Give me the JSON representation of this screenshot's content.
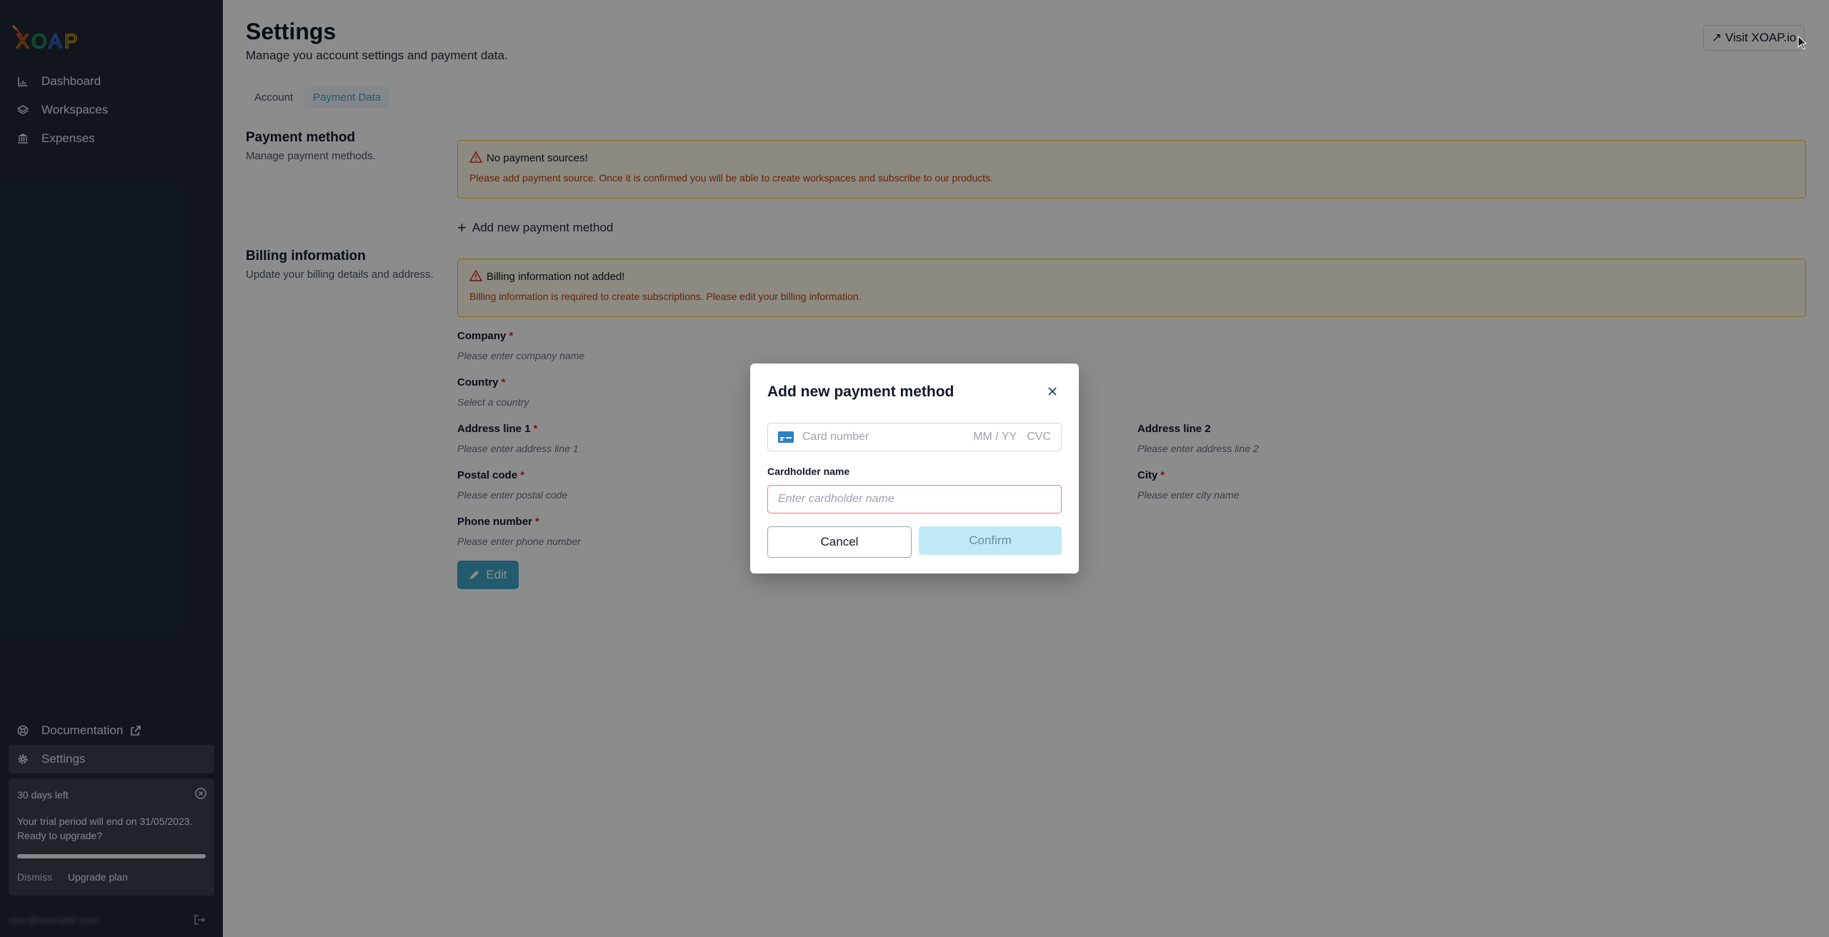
{
  "app": {
    "logo_text": "XOAP",
    "colors": {
      "accent": "#3ea6c7",
      "sidebar_bg": "#1f2937",
      "warning_bg": "#fffbeb",
      "warning_text": "#c2410c",
      "required": "#dc2626"
    }
  },
  "sidebar": {
    "items": [
      {
        "label": "Dashboard",
        "icon": "chart-icon"
      },
      {
        "label": "Workspaces",
        "icon": "layers-icon"
      },
      {
        "label": "Expenses",
        "icon": "bank-icon"
      }
    ],
    "bottom_items": [
      {
        "label": "Documentation",
        "icon": "help-circle-icon",
        "external": true
      },
      {
        "label": "Settings",
        "icon": "gear-icon",
        "active": true
      }
    ],
    "trial": {
      "title": "30 days left",
      "text": "Your trial period will end on 31/05/2023. Ready to upgrade?",
      "progress": 1.0,
      "dismiss_label": "Dismiss",
      "upgrade_label": "Upgrade plan"
    },
    "user_email": "user@example.com"
  },
  "header": {
    "title": "Settings",
    "subtitle": "Manage you account settings and payment data.",
    "visit_label": "↗ Visit XOAP.io"
  },
  "tabs": [
    {
      "label": "Account",
      "active": false
    },
    {
      "label": "Payment Data",
      "active": true
    }
  ],
  "payment": {
    "title": "Payment method",
    "desc": "Manage payment methods.",
    "alert_title": "No payment sources!",
    "alert_text": "Please add payment source. Once it is confirmed you will be able to create workspaces and subscribe to our products.",
    "add_label": "Add new payment method"
  },
  "billing": {
    "title": "Billing information",
    "desc": "Update your billing details and address.",
    "alert_title": "Billing information not added!",
    "alert_text": "Billing information is required to create subscriptions. Please edit your billing information.",
    "fields": {
      "company": {
        "label": "Company",
        "value": "Please enter company name"
      },
      "country": {
        "label": "Country",
        "value": "Select a country"
      },
      "address1": {
        "label": "Address line 1",
        "value": "Please enter address line 1"
      },
      "address2": {
        "label": "Address line 2",
        "value": "Please enter address line 2"
      },
      "postal": {
        "label": "Postal code",
        "value": "Please enter postal code"
      },
      "city": {
        "label": "City",
        "value": "Please enter city name"
      },
      "phone": {
        "label": "Phone number",
        "value": "Please enter phone number"
      }
    },
    "required_mark": "*",
    "edit_label": "Edit"
  },
  "modal": {
    "title": "Add new payment method",
    "card_placeholder": "Card number",
    "expiry_placeholder": "MM / YY",
    "cvc_placeholder": "CVC",
    "cardholder_label": "Cardholder name",
    "cardholder_placeholder": "Enter cardholder name",
    "cancel_label": "Cancel",
    "confirm_label": "Confirm"
  }
}
